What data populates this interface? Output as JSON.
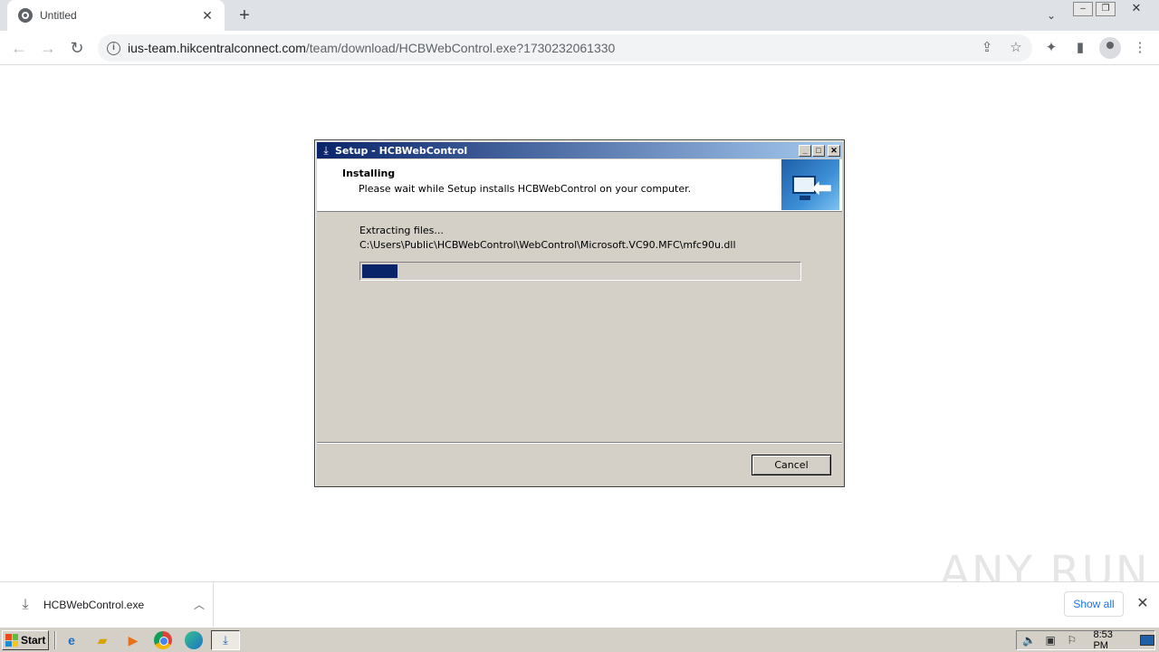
{
  "browser": {
    "tab_title": "Untitled",
    "new_tab_label": "+",
    "url_host": "ius-team.hikcentralconnect.com",
    "url_path": "/team/download/HCBWebControl.exe?1730232061330"
  },
  "dialog": {
    "title": "Setup - HCBWebControl",
    "header_title": "Installing",
    "header_subtitle": "Please wait while Setup installs HCBWebControl on your computer.",
    "status_line1": "Extracting files...",
    "status_line2": "C:\\Users\\Public\\HCBWebControl\\WebControl\\Microsoft.VC90.MFC\\mfc90u.dll",
    "progress_fraction": 0.08,
    "cancel_label": "Cancel"
  },
  "downloads": {
    "file_name": "HCBWebControl.exe",
    "show_all_label": "Show all"
  },
  "taskbar": {
    "start_label": "Start",
    "clock": "8:53 PM"
  },
  "watermark": "ANY RUN",
  "colors": {
    "titlebar_start": "#0a246a",
    "progress_fill": "#0a246a",
    "link_blue": "#1a73e8"
  }
}
